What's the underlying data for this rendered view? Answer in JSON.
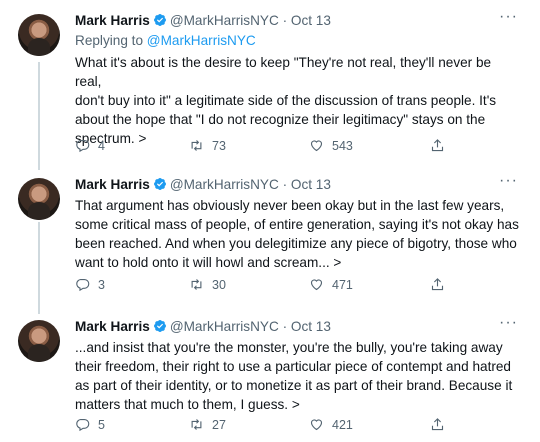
{
  "tweets": [
    {
      "name": "Mark Harris",
      "handle": "@MarkHarrisNYC",
      "dot": "·",
      "date": "Oct 13",
      "more": "···",
      "replying_prefix": "Replying to ",
      "replying_handle": "@MarkHarrisNYC",
      "lines": [
        "What it's about is the desire to keep \"They're not real, they'll never be real,",
        "don't buy into it\" a legitimate side of the discussion of trans people. It's",
        "about the hope that \"I do not recognize their legitimacy\" stays on the",
        "spectrum. >"
      ],
      "replies": "4",
      "retweets": "73",
      "likes": "543"
    },
    {
      "name": "Mark Harris",
      "handle": "@MarkHarrisNYC",
      "dot": "·",
      "date": "Oct 13",
      "more": "···",
      "lines": [
        "That argument has obviously never been okay but in the last few years,",
        "some critical mass of people, of entire generation, saying it's not okay has",
        "been reached. And when you delegitimize any piece of bigotry, those who",
        "want to hold onto it will howl and scream... >"
      ],
      "replies": "3",
      "retweets": "30",
      "likes": "471"
    },
    {
      "name": "Mark Harris",
      "handle": "@MarkHarrisNYC",
      "dot": "·",
      "date": "Oct 13",
      "more": "···",
      "lines": [
        "...and insist that you're the monster, you're the bully, you're taking away",
        "their freedom, their right to use a particular piece of contempt and hatred",
        "as part of their identity, or to monetize it as part of their brand. Because it",
        "matters that much to them, I guess. >"
      ],
      "replies": "5",
      "retweets": "27",
      "likes": "421"
    }
  ],
  "icons": {
    "verified": "verified-badge-icon",
    "reply": "reply-icon",
    "retweet": "retweet-icon",
    "like": "heart-icon",
    "share": "share-icon"
  },
  "colors": {
    "verified": "#1d9bf0",
    "link": "#1d9bf0",
    "secondary_text": "#536471",
    "primary_text": "#0f1419"
  }
}
